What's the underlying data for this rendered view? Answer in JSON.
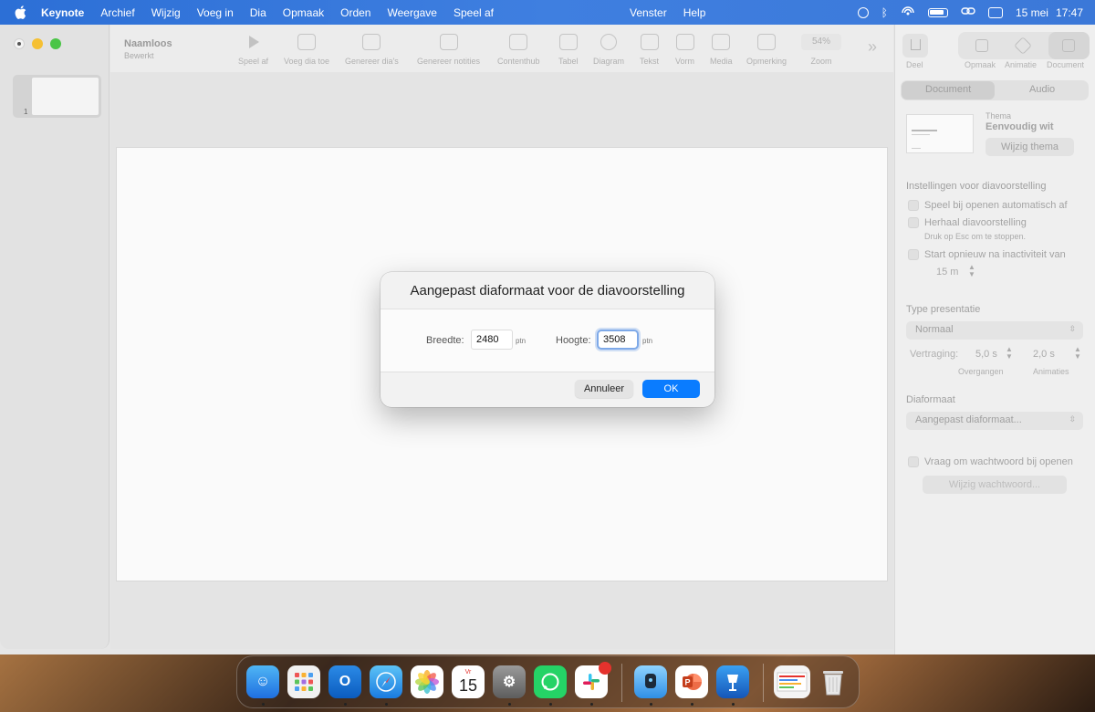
{
  "menubar": {
    "app_name": "Keynote",
    "menus": [
      "Archief",
      "Wijzig",
      "Voeg in",
      "Dia",
      "Opmaak",
      "Orden",
      "Weergave",
      "Speel af"
    ],
    "menus_right": [
      "Venster",
      "Help"
    ],
    "date": "15 mei",
    "time": "17:47"
  },
  "document": {
    "title": "Naamloos",
    "subtitle": "Bewerkt"
  },
  "toolbar": {
    "items": [
      "Speel af",
      "Voeg dia toe",
      "Genereer dia's",
      "Genereer notities",
      "Contenthub",
      "Tabel",
      "Diagram",
      "Tekst",
      "Vorm",
      "Media",
      "Opmerking",
      "Zoom"
    ],
    "zoom_value": "54%",
    "more": "»"
  },
  "slide_navigator": {
    "slide_number": "1"
  },
  "inspector": {
    "share_label": "Deel",
    "tabs": [
      "Opmaak",
      "Animatie",
      "Document"
    ],
    "segments": [
      "Document",
      "Audio"
    ],
    "theme_label": "Thema",
    "theme_name": "Eenvoudig wit",
    "change_theme": "Wijzig thema",
    "slideshow_settings_header": "Instellingen voor diavoorstelling",
    "autoplay_label": "Speel bij openen automatisch af",
    "loop_label": "Herhaal diavoorstelling",
    "loop_hint": "Druk op Esc om te stoppen.",
    "restart_label": "Start opnieuw na inactiviteit van",
    "restart_value": "15 m",
    "presentation_type_header": "Type presentatie",
    "presentation_type_value": "Normaal",
    "delay_label": "Vertraging:",
    "transitions_value": "5,0 s",
    "transitions_label": "Overgangen",
    "builds_value": "2,0 s",
    "builds_label": "Animaties",
    "slide_size_header": "Diaformaat",
    "slide_size_value": "Aangepast diaformaat...",
    "password_label": "Vraag om wachtwoord bij openen",
    "change_password": "Wijzig wachtwoord..."
  },
  "dialog": {
    "title": "Aangepast diaformaat voor de diavoorstelling",
    "width_label": "Breedte:",
    "width_value": "2480",
    "height_label": "Hoogte:",
    "height_value": "3508",
    "unit": "ptn",
    "cancel": "Annuleer",
    "ok": "OK"
  },
  "dock": {
    "calendar_day": "15",
    "calendar_weekday": "Vr"
  },
  "colors": {
    "accent": "#0a7cff",
    "menubar": "#3b78d8"
  }
}
